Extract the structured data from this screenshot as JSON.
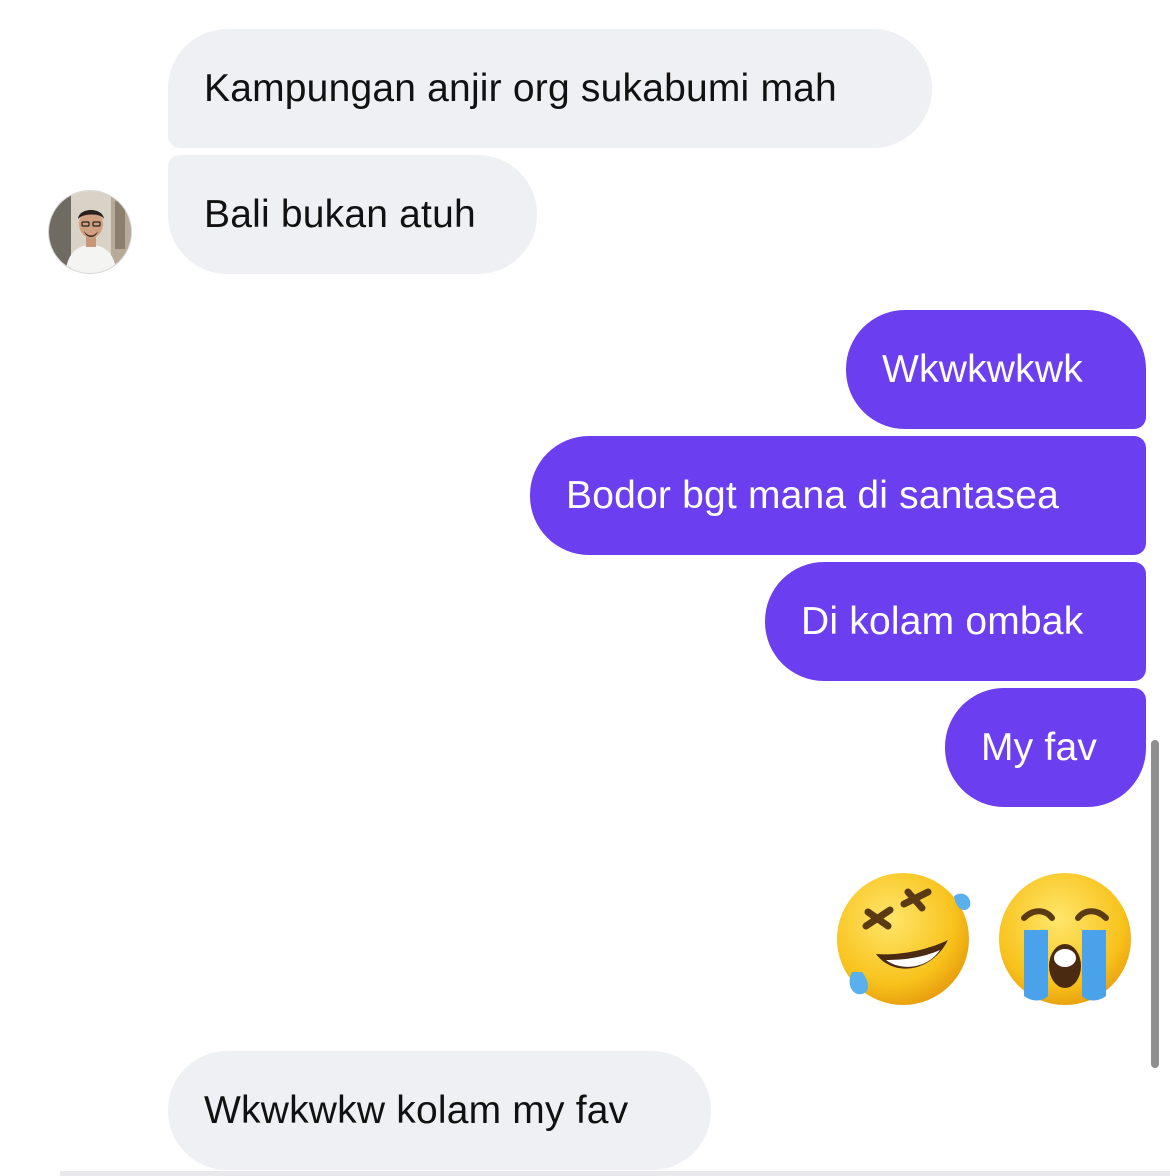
{
  "conversation": {
    "messages": [
      {
        "direction": "incoming",
        "text": "Kampungan anjir org sukabumi mah"
      },
      {
        "direction": "incoming",
        "text": "Bali bukan atuh"
      },
      {
        "direction": "outgoing",
        "text": "Wkwkwkwk"
      },
      {
        "direction": "outgoing",
        "text": "Bodor bgt mana di santasea"
      },
      {
        "direction": "outgoing",
        "text": "Di kolam ombak"
      },
      {
        "direction": "outgoing",
        "text": "My fav"
      },
      {
        "direction": "outgoing",
        "emoji": [
          "rolling-on-the-floor-laughing",
          "loudly-crying-face"
        ]
      },
      {
        "direction": "incoming",
        "text": "Wkwkwkw kolam my fav"
      }
    ]
  },
  "colors": {
    "incoming_bubble": "#eff0f4",
    "outgoing_bubble": "#6b3ef0",
    "incoming_text": "#111111",
    "outgoing_text": "#ffffff"
  }
}
